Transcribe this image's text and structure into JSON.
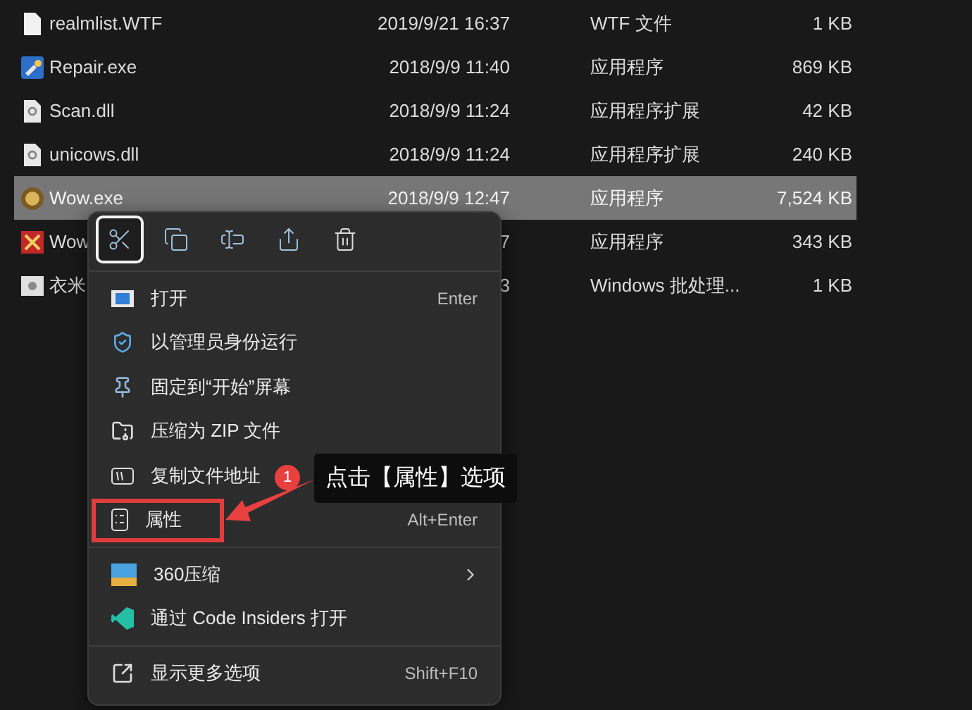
{
  "files": [
    {
      "kind": "text",
      "name": "realmlist.WTF",
      "date": "2019/9/21 16:37",
      "type": "WTF 文件",
      "size": "1 KB",
      "selected": false
    },
    {
      "kind": "repair",
      "name": "Repair.exe",
      "date": "2018/9/9 11:40",
      "type": "应用程序",
      "size": "869 KB",
      "selected": false
    },
    {
      "kind": "dll",
      "name": "Scan.dll",
      "date": "2018/9/9 11:24",
      "type": "应用程序扩展",
      "size": "42 KB",
      "selected": false
    },
    {
      "kind": "dll",
      "name": "unicows.dll",
      "date": "2018/9/9 11:24",
      "type": "应用程序扩展",
      "size": "240 KB",
      "selected": false
    },
    {
      "kind": "wow",
      "name": "Wow.exe",
      "date": "2018/9/9 12:47",
      "type": "应用程序",
      "size": "7,524 KB",
      "selected": true
    },
    {
      "kind": "red",
      "name": "Wow",
      "date": "7",
      "type": "应用程序",
      "size": "343 KB",
      "selected": false
    },
    {
      "kind": "bat",
      "name": "衣米",
      "date": "3",
      "type": "Windows 批处理...",
      "size": "1 KB",
      "selected": false
    }
  ],
  "context_menu": {
    "toolbar": [
      {
        "kind": "cut",
        "selected": true
      },
      {
        "kind": "copy",
        "selected": false
      },
      {
        "kind": "rename",
        "selected": false
      },
      {
        "kind": "share",
        "selected": false
      },
      {
        "kind": "delete",
        "selected": false
      }
    ],
    "groups": [
      [
        {
          "kind": "open",
          "label": "打开",
          "shortcut": "Enter",
          "highlighted": false
        },
        {
          "kind": "admin",
          "label": "以管理员身份运行",
          "highlighted": false
        },
        {
          "kind": "pin",
          "label": "固定到“开始”屏幕",
          "highlighted": false
        },
        {
          "kind": "zip",
          "label": "压缩为 ZIP 文件",
          "highlighted": false
        },
        {
          "kind": "path",
          "label": "复制文件地址",
          "highlighted": false
        },
        {
          "kind": "properties",
          "label": "属性",
          "shortcut": "Alt+Enter",
          "highlighted": true
        }
      ],
      [
        {
          "kind": "archive",
          "label": "360压缩",
          "submenu": true,
          "highlighted": false
        },
        {
          "kind": "code",
          "label": "通过 Code Insiders 打开",
          "highlighted": false
        }
      ],
      [
        {
          "kind": "more",
          "label": "显示更多选项",
          "shortcut": "Shift+F10",
          "highlighted": false
        }
      ]
    ]
  },
  "annotation": {
    "step": "1",
    "text": "点击【属性】选项"
  }
}
